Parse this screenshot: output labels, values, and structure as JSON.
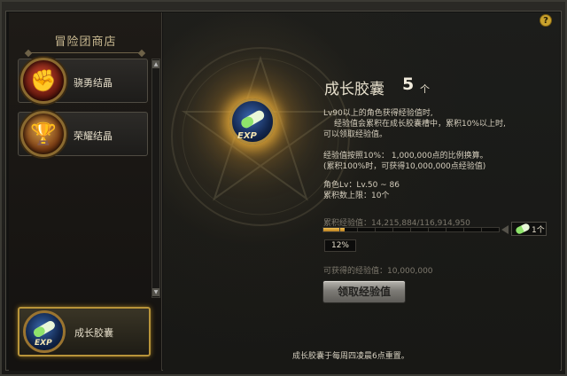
{
  "shop": {
    "title": "冒险团商店",
    "items": [
      {
        "label": "骁勇结晶",
        "icon": "fist-icon"
      },
      {
        "label": "荣耀结晶",
        "icon": "trophy-icon"
      }
    ],
    "selected": {
      "label": "成长胶囊",
      "icon": "exp-capsule-icon"
    }
  },
  "detail": {
    "title": "成长胶囊",
    "count": "5",
    "count_unit": "个",
    "desc_line1": "Lv90以上的角色获得经验值时,",
    "desc_line2": "经验值会累积在成长胶囊槽中，累积10%以上时,",
    "desc_line3": "可以领取经验值。",
    "desc_line4": "经验值按照10%： 1,000,000点的比例换算。",
    "desc_line5": "(累积100%时，可获得10,000,000点经验值)",
    "desc_line6": "角色Lv：Lv.50 ~ 86",
    "desc_line7": "累积数上限：10个",
    "accumulated_label": "累积经验值：14,215,884/116,914,950",
    "progress": 0.12,
    "progress_label": "12%",
    "capsule_count": "1个",
    "obtainable_label": "可获得的经验值：10,000,000",
    "claim_button": "领取经验值",
    "exp_badge": "EXP",
    "footer": "成长胶囊于每周四凌晨6点重置。"
  },
  "help": "?",
  "scroll": {
    "up": "▲",
    "down": "▼"
  },
  "colors": {
    "accent_gold": "#b8943a",
    "progress_fill": "#f2c253"
  }
}
